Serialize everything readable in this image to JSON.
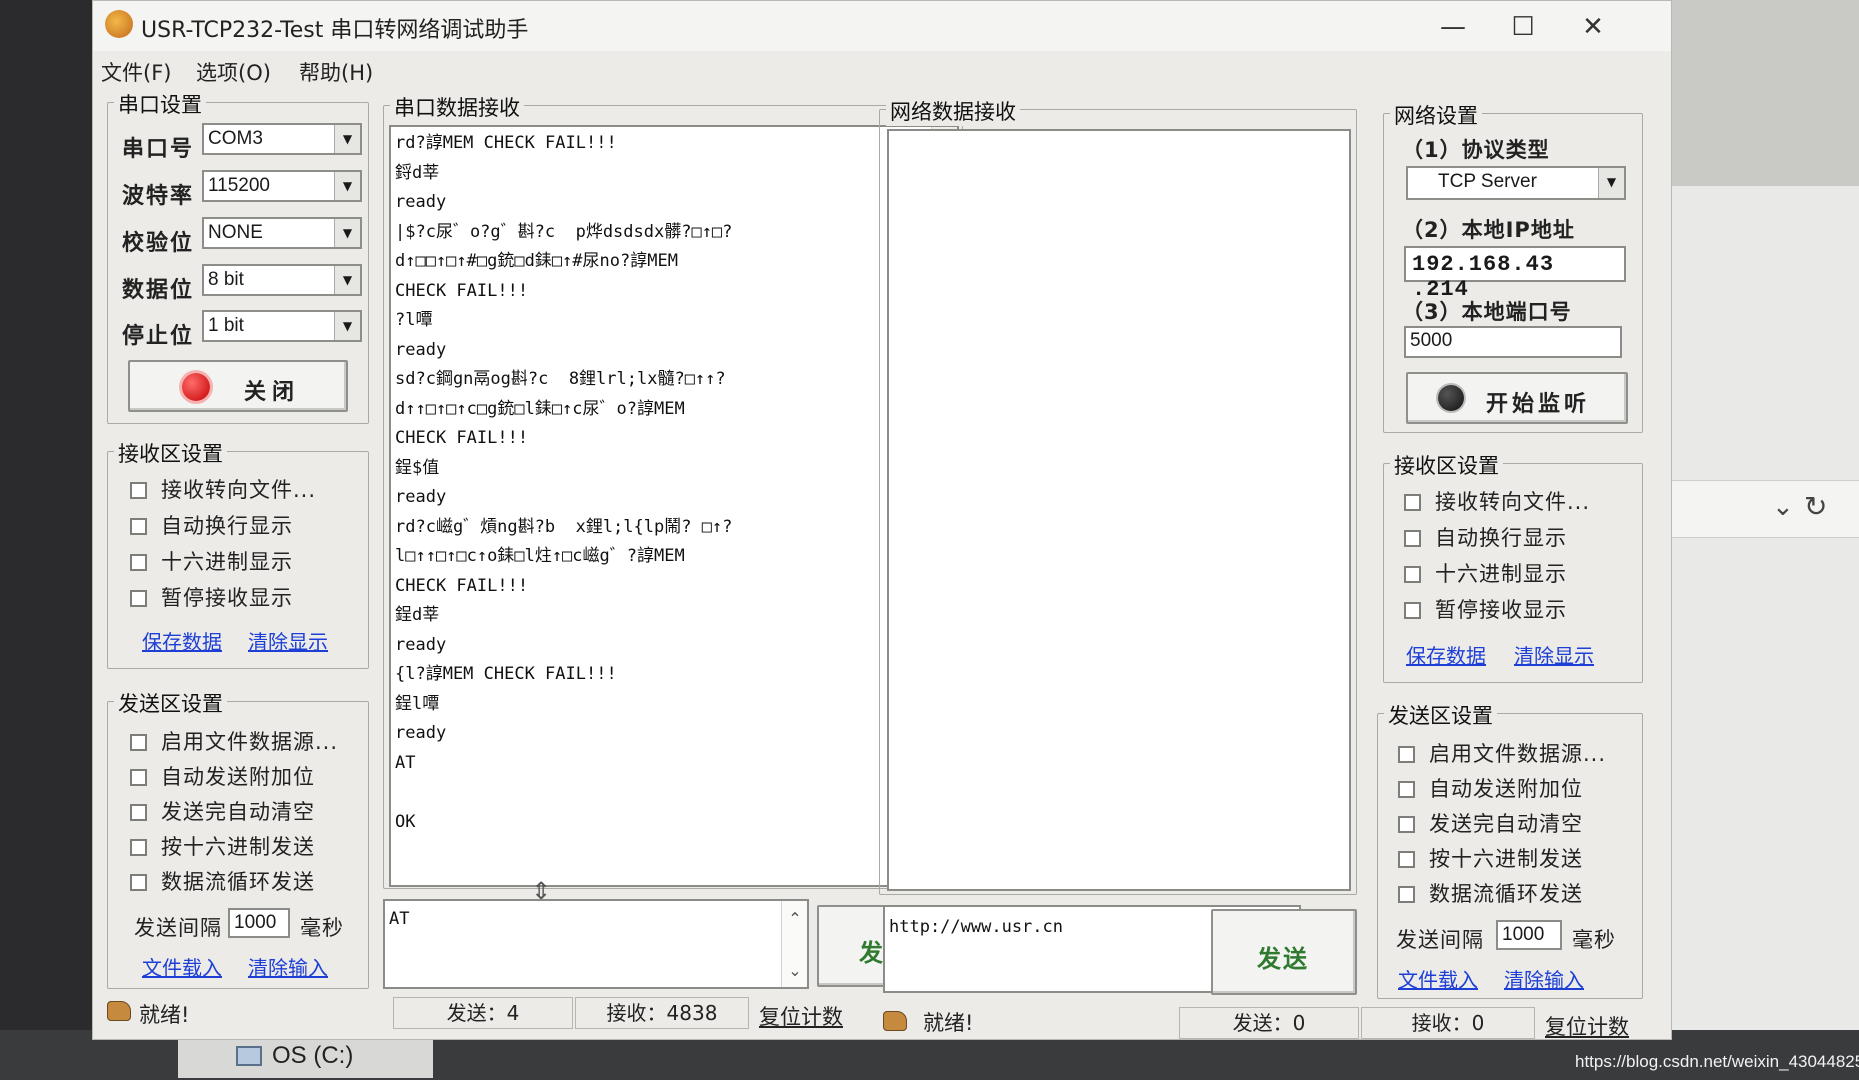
{
  "window": {
    "title": "USR-TCP232-Test 串口转网络调试助手",
    "minimize_glyph": "—",
    "maximize_glyph": "☐",
    "close_glyph": "✕"
  },
  "menu": [
    "文件(F)",
    "选项(O)",
    "帮助(H)"
  ],
  "serial_settings": {
    "title": "串口设置",
    "port_label": "串口号",
    "port_value": "COM3",
    "baud_label": "波特率",
    "baud_value": "115200",
    "parity_label": "校验位",
    "parity_value": "NONE",
    "databits_label": "数据位",
    "databits_value": "8 bit",
    "stopbits_label": "停止位",
    "stopbits_value": "1 bit",
    "close_button": "关闭"
  },
  "serial_recv_settings": {
    "title": "接收区设置",
    "options": [
      "接收转向文件...",
      "自动换行显示",
      "十六进制显示",
      "暂停接收显示"
    ],
    "save_link": "保存数据",
    "clear_link": "清除显示"
  },
  "serial_send_settings": {
    "title": "发送区设置",
    "options": [
      "启用文件数据源...",
      "自动发送附加位",
      "发送完自动清空",
      "按十六进制发送",
      "数据流循环发送"
    ],
    "interval_label": "发送间隔",
    "interval_value": "1000",
    "interval_unit": "毫秒",
    "load_link": "文件载入",
    "clear_link": "清除输入"
  },
  "serial_recv": {
    "title": "串口数据接收",
    "lines": [
      "rd?諄MEM CHECK FAIL!!!",
      "鋝d莘",
      "ready",
      "|$?c尿゛o?g゛斟?c  p烨dsdsdx髒?□↑□?",
      "d↑□□↑□↑#□g銃□d銇□↑#尿no?諄MEM",
      "CHECK FAIL!!!",
      "?l嘾",
      "ready",
      "sd?c鋼gn鬲og斟?c  8鋰lrl;lx髓?□↑↑?",
      "d↑↑□↑□↑c□g銃□l銇□↑c尿゛o?諄MEM",
      "CHECK FAIL!!!",
      "鋥$值",
      "ready",
      "rd?c嵫g゛熕ng斟?b  x鋰l;l{lp鬧? □↑?",
      "l□↑↑□↑□c↑o銇□l炷↑□c嵫g゛?諄MEM",
      "CHECK FAIL!!!",
      "鋥d莘",
      "ready",
      "{l?諄MEM CHECK FAIL!!!",
      "鋥l嘾",
      "ready",
      "AT",
      "",
      "OK"
    ]
  },
  "serial_send": {
    "input_value": "AT",
    "send_button": "发送"
  },
  "net_recv": {
    "title": "网络数据接收"
  },
  "net_send": {
    "input_value": "http://www.usr.cn",
    "send_button": "发送"
  },
  "net_settings": {
    "title": "网络设置",
    "protocol_label": "（1）协议类型",
    "protocol_value": "TCP Server",
    "ip_label": "（2）本地IP地址",
    "ip_value": "192.168.43 .214",
    "port_label": "（3）本地端口号",
    "port_value": "5000",
    "listen_button": "开始监听"
  },
  "net_recv_settings": {
    "title": "接收区设置",
    "options": [
      "接收转向文件...",
      "自动换行显示",
      "十六进制显示",
      "暂停接收显示"
    ],
    "save_link": "保存数据",
    "clear_link": "清除显示"
  },
  "net_send_settings": {
    "title": "发送区设置",
    "options": [
      "启用文件数据源...",
      "自动发送附加位",
      "发送完自动清空",
      "按十六进制发送",
      "数据流循环发送"
    ],
    "interval_label": "发送间隔",
    "interval_value": "1000",
    "interval_unit": "毫秒",
    "load_link": "文件载入",
    "clear_link": "清除输入"
  },
  "status_left": {
    "ready": "就绪!",
    "sent": "发送：4",
    "received": "接收：4838",
    "reset": "复位计数"
  },
  "status_right": {
    "ready": "就绪!",
    "sent": "发送：0",
    "received": "接收：0",
    "reset": "复位计数"
  },
  "taskbar": {
    "drive": "OS (C:)"
  },
  "watermark": "https://blog.csdn.net/weixin_43044825"
}
